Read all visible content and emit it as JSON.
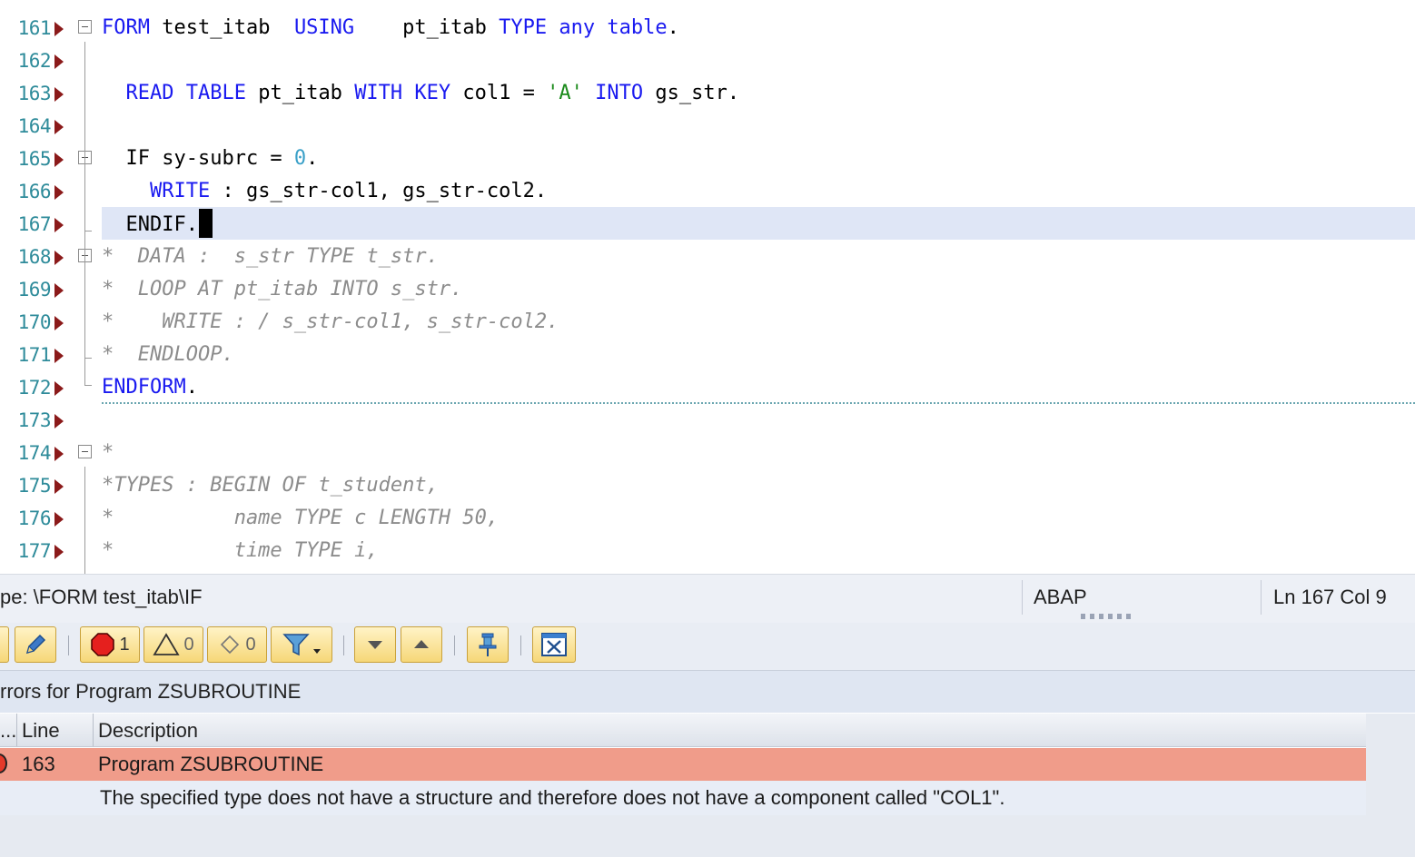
{
  "editor": {
    "lines": [
      {
        "no": "161",
        "html": "<span class=\"kw\">FORM</span> test_itab  <span class=\"kw\">USING</span>    pt_itab <span class=\"kw\">TYPE</span> <span class=\"kw\">any</span> <span class=\"kw\">table</span>."
      },
      {
        "no": "162",
        "html": ""
      },
      {
        "no": "163",
        "html": "  <span class=\"kw\">READ</span> <span class=\"kw\">TABLE</span> pt_itab <span class=\"kw\">WITH</span> <span class=\"kw\">KEY</span> col1 = <span class=\"str\">'A'</span> <span class=\"kw\">INTO</span> gs_str."
      },
      {
        "no": "164",
        "html": ""
      },
      {
        "no": "165",
        "html": "  IF sy-subrc = <span class=\"num\">0</span>."
      },
      {
        "no": "166",
        "html": "    <span class=\"kw\">WRITE</span> : gs_str-col1, gs_str-col2."
      },
      {
        "no": "167",
        "html": "  ENDIF.<span class=\"cursor-block\"></span>"
      },
      {
        "no": "168",
        "html": "<span class=\"cmt\">*  DATA :  s_str TYPE t_str.</span>"
      },
      {
        "no": "169",
        "html": "<span class=\"cmt\">*  LOOP AT pt_itab INTO s_str.</span>"
      },
      {
        "no": "170",
        "html": "<span class=\"cmt\">*    WRITE : / s_str-col1, s_str-col2.</span>"
      },
      {
        "no": "171",
        "html": "<span class=\"cmt\">*  ENDLOOP.</span>"
      },
      {
        "no": "172",
        "html": "<span class=\"kw\">ENDFORM</span>."
      },
      {
        "no": "173",
        "html": ""
      },
      {
        "no": "174",
        "html": "<span class=\"cmt\">*</span>"
      },
      {
        "no": "175",
        "html": "<span class=\"cmt\">*TYPES : BEGIN OF t_student,</span>"
      },
      {
        "no": "176",
        "html": "<span class=\"cmt\">*          name TYPE c LENGTH 50,</span>"
      },
      {
        "no": "177",
        "html": "<span class=\"cmt\">*          time TYPE i,</span>"
      }
    ],
    "current_line": "167"
  },
  "statusbar": {
    "path": "pe: \\FORM test_itab\\IF",
    "language": "ABAP",
    "position": "Ln 167 Col  9"
  },
  "toolbar": {
    "errors_count": "1",
    "warnings_count": "0",
    "info_count": "0",
    "icons": [
      "edit-icon",
      "error-filter-icon",
      "warning-filter-icon",
      "info-filter-icon",
      "funnel-icon",
      "arrow-down-icon",
      "arrow-up-icon",
      "pin-icon",
      "close-window-icon"
    ]
  },
  "errors_panel": {
    "title": "rrors for Program ZSUBROUTINE",
    "columns": [
      "...",
      "Line",
      "Description"
    ],
    "rows": [
      {
        "line": "163",
        "description": "Program ZSUBROUTINE",
        "detail": "The specified type does not have a structure and therefore does not have a component called \"COL1\"."
      }
    ],
    "colors": {
      "error_row": "#f09c8a",
      "detail_row": "#e8edf6"
    }
  }
}
